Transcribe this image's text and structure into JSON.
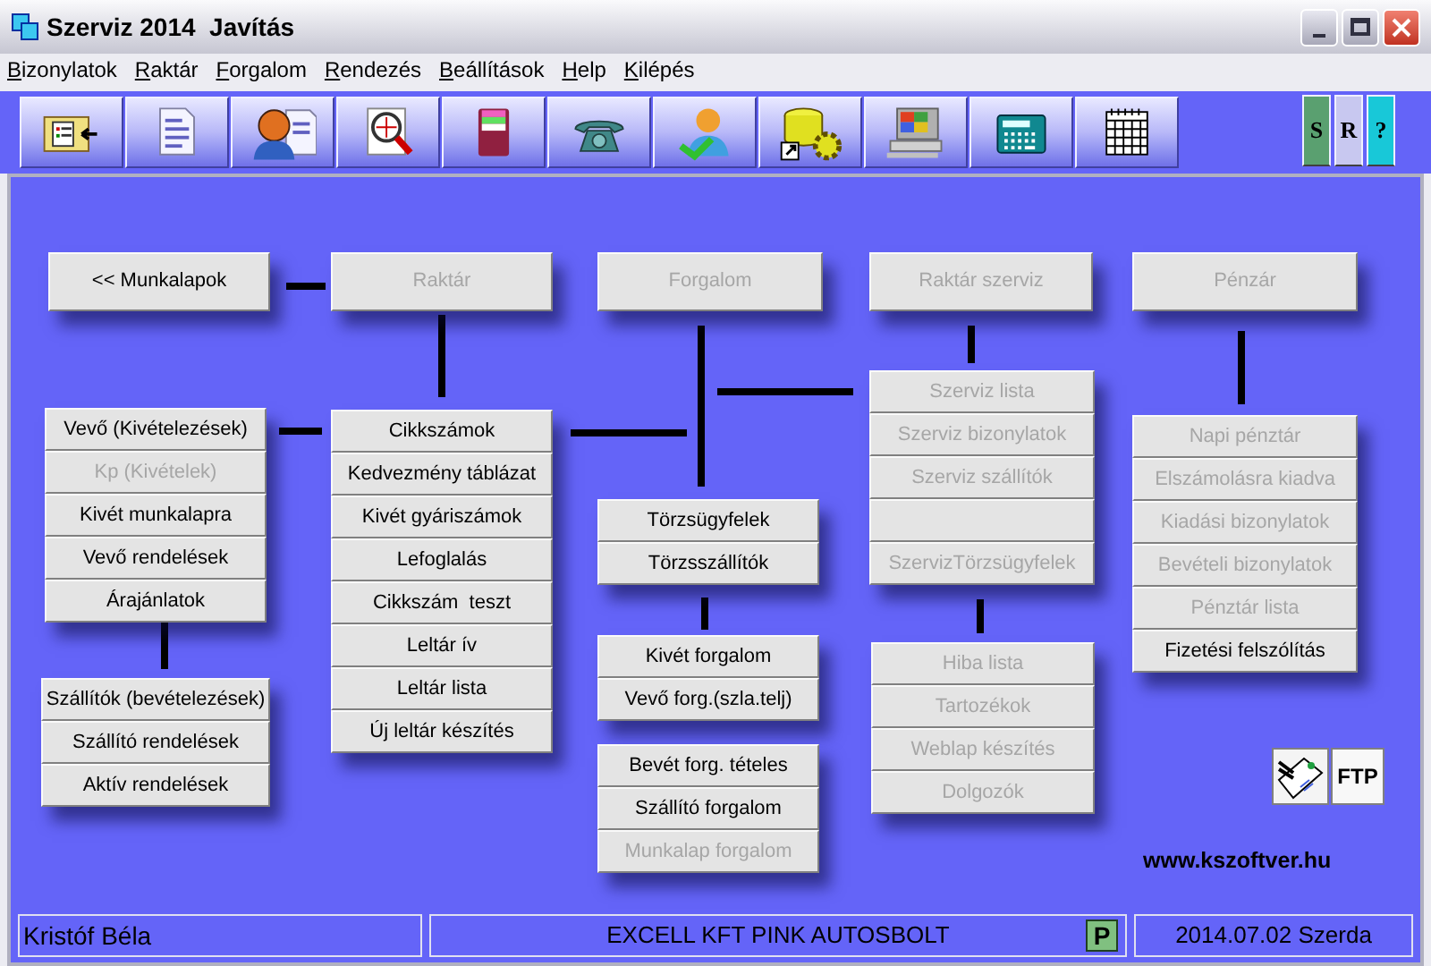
{
  "window": {
    "title": "Szerviz 2014  Javítás"
  },
  "menu": [
    "Bizonylatok",
    "Raktár",
    "Forgalom",
    "Rendezés",
    "Beállítások",
    "Help",
    "Kilépés"
  ],
  "side_buttons": [
    {
      "label": "S",
      "color": "#5aa070"
    },
    {
      "label": "R",
      "color": "#c8c8f0"
    },
    {
      "label": "?",
      "color": "#18c8d8"
    }
  ],
  "groups": [
    {
      "buttons": [
        {
          "label": "<< Munkalapok",
          "disabled": false
        }
      ]
    },
    {
      "buttons": [
        {
          "label": "Raktár",
          "disabled": true
        }
      ]
    },
    {
      "buttons": [
        {
          "label": "Forgalom",
          "disabled": true
        }
      ]
    },
    {
      "buttons": [
        {
          "label": "Raktár szerviz",
          "disabled": true
        }
      ]
    },
    {
      "buttons": [
        {
          "label": "Pénzár",
          "disabled": true
        }
      ]
    },
    {
      "buttons": [
        {
          "label": "Vevő (Kivételezések)",
          "disabled": false
        },
        {
          "label": "Kp (Kivételek)",
          "disabled": true
        },
        {
          "label": "Kivét munkalapra",
          "disabled": false
        },
        {
          "label": "Vevő rendelések",
          "disabled": false
        },
        {
          "label": "Árajánlatok",
          "disabled": false
        }
      ]
    },
    {
      "buttons": [
        {
          "label": "Cikkszámok",
          "disabled": false
        },
        {
          "label": "Kedvezmény táblázat",
          "disabled": false
        },
        {
          "label": "Kivét gyáriszámok",
          "disabled": false
        },
        {
          "label": "Lefoglalás",
          "disabled": false
        },
        {
          "label": "Cikkszám  teszt",
          "disabled": false
        },
        {
          "label": "Leltár ív",
          "disabled": false
        },
        {
          "label": "Leltár lista",
          "disabled": false
        },
        {
          "label": "Új leltár készítés",
          "disabled": false
        }
      ]
    },
    {
      "buttons": [
        {
          "label": "Törzsügyfelek",
          "disabled": false
        },
        {
          "label": "Törzsszállítók",
          "disabled": false
        }
      ]
    },
    {
      "buttons": [
        {
          "label": "Kivét forgalom",
          "disabled": false
        },
        {
          "label": "Vevő forg.(szla.telj)",
          "disabled": false
        }
      ]
    },
    {
      "buttons": [
        {
          "label": "Bevét forg. tételes",
          "disabled": false
        },
        {
          "label": "Szállító forgalom",
          "disabled": false
        },
        {
          "label": "Munkalap forgalom",
          "disabled": true
        }
      ]
    },
    {
      "buttons": [
        {
          "kind": "button",
          "label": "Szerviz lista",
          "disabled": true
        },
        {
          "kind": "button",
          "label": "Szerviz bizonylatok",
          "disabled": true
        },
        {
          "kind": "button",
          "label": "Szerviz szállítók",
          "disabled": true
        },
        {
          "kind": "blank"
        },
        {
          "kind": "button",
          "label": "SzervizTörzsügyfelek",
          "disabled": true
        }
      ]
    },
    {
      "buttons": [
        {
          "label": "Hiba lista",
          "disabled": true
        },
        {
          "label": "Tartozékok",
          "disabled": true
        },
        {
          "label": "Weblap készítés",
          "disabled": true
        },
        {
          "label": "Dolgozók",
          "disabled": true
        }
      ]
    },
    {
      "buttons": [
        {
          "label": "Napi pénztár",
          "disabled": true
        },
        {
          "label": "Elszámolásra kiadva",
          "disabled": true
        },
        {
          "label": "Kiadási bizonylatok",
          "disabled": true
        },
        {
          "label": "Bevételi bizonylatok",
          "disabled": true
        },
        {
          "label": "Pénztár lista",
          "disabled": true
        },
        {
          "label": "Fizetési felszólítás",
          "disabled": false
        }
      ]
    },
    {
      "buttons": [
        {
          "label": "Szállítók (bevételezések)",
          "disabled": false
        },
        {
          "label": "Szállító rendelések",
          "disabled": false
        },
        {
          "label": "Aktív rendelések",
          "disabled": false
        }
      ]
    }
  ],
  "ftp_button": "FTP",
  "website": "www.kszoftver.hu",
  "status_bar": {
    "user": "Kristóf Béla",
    "company": "EXCELL KFT PINK AUTOSBOLT",
    "p_button": "P",
    "date": "2014.07.02 Szerda"
  }
}
